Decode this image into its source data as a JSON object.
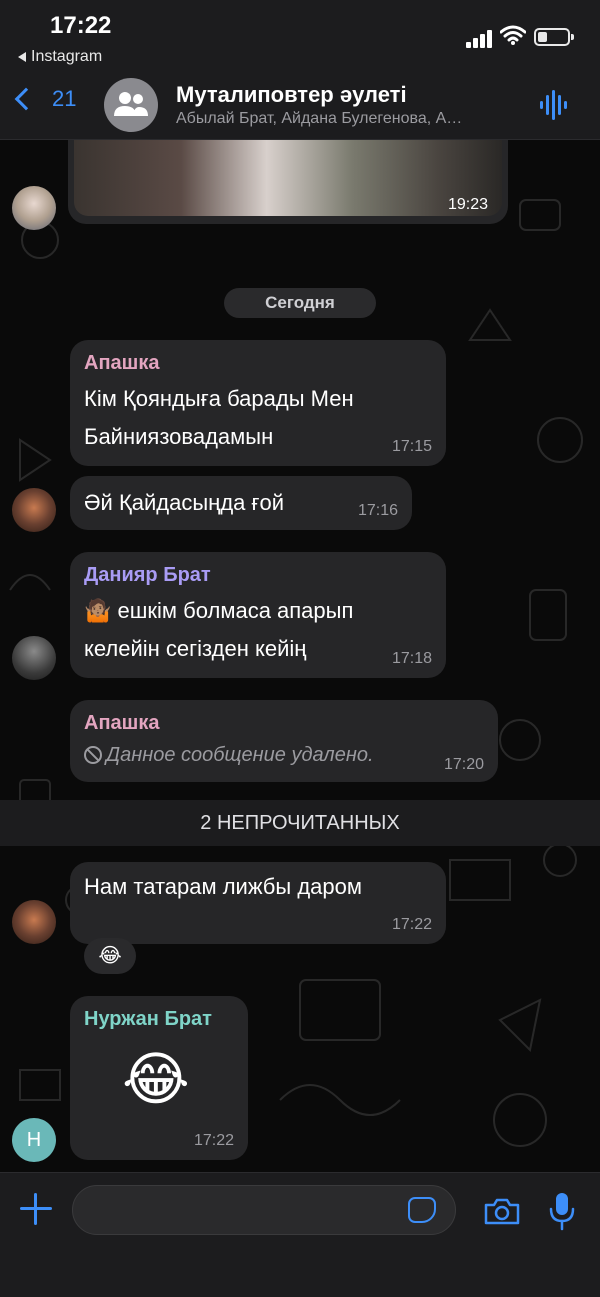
{
  "status_bar": {
    "time": "17:22",
    "back_app": "Instagram"
  },
  "header": {
    "back_count": "21",
    "title": "Муталиповтер әулеті",
    "subtitle": "Абылай Брат, Айдана Булегенова, А…"
  },
  "chat": {
    "photo_time": "19:23",
    "day_label": "Сегодня",
    "messages": [
      {
        "sender": "Апашка",
        "sender_color": "#e3a5c0",
        "lines": [
          "Кім Қояндыға барады Мен",
          "Байниязовадамын"
        ],
        "time": "17:15"
      },
      {
        "sender": "",
        "lines": [
          "Әй Қайдасыңда ғой"
        ],
        "time": "17:16"
      },
      {
        "sender": "Данияр Брат",
        "sender_color": "#a99cf5",
        "lines": [
          "🤷🏽 ешкім болмаса апарып",
          "келейін сегізден кейің"
        ],
        "time": "17:18"
      },
      {
        "sender": "Апашка",
        "sender_color": "#e3a5c0",
        "deleted_text": "Данное сообщение удалено.",
        "time": "17:20"
      },
      {
        "sender": "",
        "lines": [
          "Нам татарам лижбы даром"
        ],
        "time": "17:22",
        "reaction": "😂"
      },
      {
        "sender": "Нуржан Брат",
        "sender_color": "#7fd4c8",
        "emoji": "😂",
        "time": "17:22",
        "avatar_letter": "Н"
      }
    ],
    "unread_label": "2 НЕПРОЧИТАННЫХ"
  },
  "icons": {
    "back": "chevron-left-icon",
    "group": "group-avatar-icon",
    "audio": "audio-wave-icon",
    "plus": "plus-icon",
    "sticker": "sticker-icon",
    "camera": "camera-icon",
    "mic": "microphone-icon",
    "deleted": "prohibited-icon"
  },
  "colors": {
    "accent": "#3d8ef8",
    "bubble": "#262628",
    "bar": "#1c1c1e"
  }
}
